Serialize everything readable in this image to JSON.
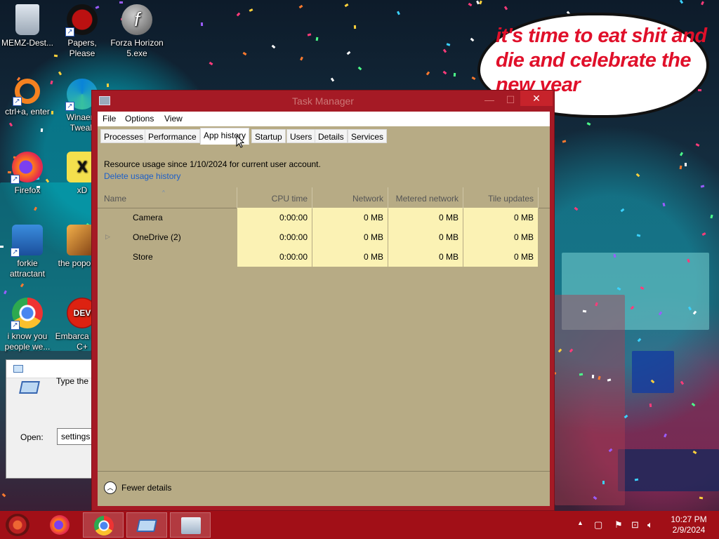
{
  "desktop": {
    "icons": [
      {
        "label": "MEMZ-Dest...",
        "icon": "recycle-bin-icon"
      },
      {
        "label": "Papers, Please",
        "icon": "papers-please-icon"
      },
      {
        "label": "Forza Horizon 5.exe",
        "icon": "flash-player-icon"
      },
      {
        "label": "ctrl+a, enter",
        "icon": "origin-icon"
      },
      {
        "label": "Winaero Tweak",
        "icon": "edge-icon"
      },
      {
        "label": "Firefox",
        "icon": "firefox-icon"
      },
      {
        "label": "xD",
        "icon": "xd-icon"
      },
      {
        "label": "forkie attractant",
        "icon": "control-panel-icon"
      },
      {
        "label": "the popo shit",
        "icon": "media-icon"
      },
      {
        "label": "i know you people we...",
        "icon": "chrome-icon"
      },
      {
        "label": "Embarca Dev-C+",
        "icon": "devcpp-icon"
      }
    ],
    "bubble_text": "it's time to eat shit and die and celebrate the new year"
  },
  "run_dialog": {
    "description": "Type the name of a program, folder, document, or Internet resource,",
    "open_label": "Open:",
    "open_value": "settings"
  },
  "task_manager": {
    "title": "Task Manager",
    "minimize_glyph": "—",
    "maximize_glyph": "☐",
    "close_glyph": "✕",
    "menus": [
      "File",
      "Options",
      "View"
    ],
    "tabs": [
      "Processes",
      "Performance",
      "App history",
      "Startup",
      "Users",
      "Details",
      "Services"
    ],
    "active_tab": "App history",
    "resource_text": "Resource usage since 1/10/2024 for current user account.",
    "delete_link": "Delete usage history",
    "columns": [
      "Name",
      "CPU time",
      "Network",
      "Metered network",
      "Tile updates"
    ],
    "rows": [
      {
        "name": "Camera",
        "expandable": false,
        "cpu": "0:00:00",
        "network": "0 MB",
        "metered": "0 MB",
        "tile": "0 MB"
      },
      {
        "name": "OneDrive (2)",
        "expandable": true,
        "cpu": "0:00:00",
        "network": "0 MB",
        "metered": "0 MB",
        "tile": "0 MB"
      },
      {
        "name": "Store",
        "expandable": false,
        "cpu": "0:00:00",
        "network": "0 MB",
        "metered": "0 MB",
        "tile": "0 MB"
      }
    ],
    "fewer_details": "Fewer details"
  },
  "taskbar": {
    "pinned": [
      "start-orb",
      "firefox",
      "chrome",
      "run-dialog",
      "task-manager"
    ],
    "active": "task-manager",
    "time": "10:27 PM",
    "date": "2/9/2024"
  },
  "colors": {
    "window_frame": "#a51a25",
    "client_bg": "#b7ab85",
    "heat_cell": "#fbf2b4",
    "taskbar": "#a10f17",
    "link": "#1c5fc9"
  }
}
